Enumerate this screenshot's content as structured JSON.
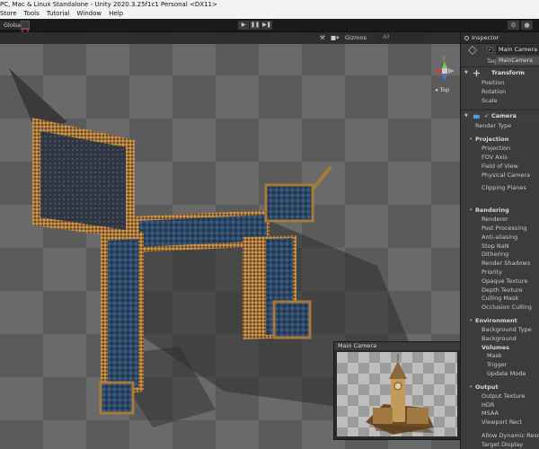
{
  "window": {
    "title": "PC, Mac & Linux Standalone - Unity 2020.3.25f1c1 Personal <DX11>"
  },
  "menu": [
    "Store",
    "Tools",
    "Tutorial",
    "Window",
    "Help"
  ],
  "toolbar": {
    "global_label": "Global",
    "play_icons": [
      "▶",
      "❚❚",
      "▶❚"
    ]
  },
  "scene_toolbar": {
    "gizmos_label": "Gizmos",
    "search_placeholder": "All"
  },
  "gizmo": {
    "y_axis": "y",
    "view_label": "Top"
  },
  "camera_preview": {
    "title": "Main Camera"
  },
  "inspector": {
    "tab": "Inspector",
    "object_name": "Main Camera",
    "tag_label": "Tag",
    "tag_value": "MainCamera",
    "transform": {
      "header": "Transform",
      "rows": [
        "Position",
        "Rotation",
        "Scale"
      ]
    },
    "camera": {
      "header": "Camera",
      "render_type": "Render Type",
      "projection": {
        "header": "Projection",
        "rows": [
          "Projection",
          "FOV Axis",
          "Field of View",
          "Physical Camera"
        ],
        "clipping": "Clipping Planes"
      },
      "rendering": {
        "header": "Rendering",
        "rows": [
          "Renderer",
          "Post Processing",
          "Anti-aliasing",
          "Stop NaN",
          "Dithering",
          "Render Shadows",
          "Priority",
          "Opaque Texture",
          "Depth Texture",
          "Culling Mask",
          "Occlusion Culling"
        ]
      },
      "environment": {
        "header": "Environment",
        "rows": [
          "Background Type",
          "Background"
        ],
        "volumes_header": "Volumes",
        "volume_rows": [
          "Mask",
          "Trigger",
          "Update Mode"
        ]
      },
      "output": {
        "header": "Output",
        "rows": [
          "Output Texture",
          "HDR",
          "MSAA",
          "Viewport Rect"
        ],
        "extra": [
          "Allow Dynamic Resolution",
          "Target Display"
        ]
      }
    }
  },
  "colors": {
    "editor_bg": "#383838",
    "toolbar_bg": "#191919",
    "inspector_bg": "#3c3c3c",
    "axis_x": "#d23c3c",
    "axis_y": "#7fc43a",
    "axis_z": "#3c78e6",
    "camera_icon": "#4aa3e8"
  }
}
